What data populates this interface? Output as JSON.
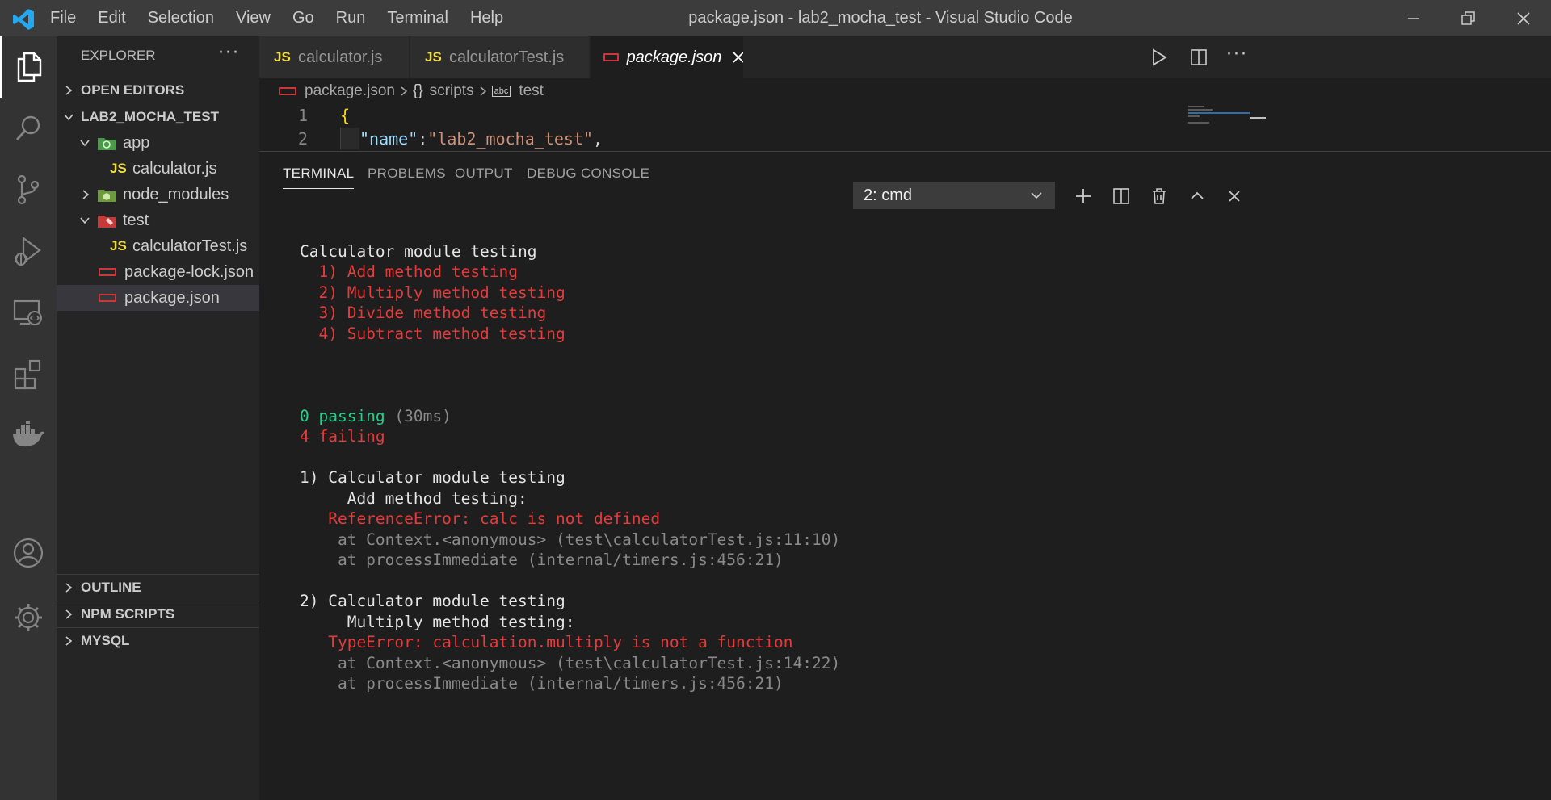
{
  "window": {
    "title": "package.json - lab2_mocha_test - Visual Studio Code",
    "menu": [
      "File",
      "Edit",
      "Selection",
      "View",
      "Go",
      "Run",
      "Terminal",
      "Help"
    ]
  },
  "sidebar": {
    "header": "EXPLORER",
    "more": "···",
    "sections": {
      "open_editors": "OPEN EDITORS",
      "project": "LAB2_MOCHA_TEST",
      "outline": "OUTLINE",
      "npm_scripts": "NPM SCRIPTS",
      "mysql": "MYSQL"
    },
    "tree": {
      "app": "app",
      "calculator_js": "calculator.js",
      "node_modules": "node_modules",
      "test": "test",
      "calculator_test_js": "calculatorTest.js",
      "package_lock": "package-lock.json",
      "package_json": "package.json"
    },
    "js_badge": "JS"
  },
  "tabs": [
    {
      "label": "calculator.js"
    },
    {
      "label": "calculatorTest.js"
    },
    {
      "label": "package.json"
    }
  ],
  "breadcrumb": {
    "file": "package.json",
    "scripts_icon": "{}",
    "scripts": "scripts",
    "test_icon": "abc",
    "test": "test"
  },
  "editor": {
    "lines": [
      {
        "num": "1",
        "brace": "{"
      },
      {
        "num": "2",
        "key": "\"name\"",
        "sep": ": ",
        "value": "\"lab2_mocha_test\"",
        "end": ","
      }
    ]
  },
  "panel": {
    "tabs": [
      "TERMINAL",
      "PROBLEMS",
      "OUTPUT",
      "DEBUG CONSOLE"
    ],
    "terminal_select": "2: cmd",
    "output": {
      "suite": "Calculator module testing",
      "tests": [
        "  1) Add method testing",
        "  2) Multiply method testing",
        "  3) Divide method testing",
        "  4) Subtract method testing"
      ],
      "passing": "0 passing",
      "duration": " (30ms)",
      "failing": "4 failing",
      "failure1": {
        "head": "1) Calculator module testing",
        "test": "     Add method testing:",
        "error": "   ReferenceError: calc is not defined",
        "stack1": "    at Context.<anonymous> (test\\calculatorTest.js:11:10)",
        "stack2": "    at processImmediate (internal/timers.js:456:21)"
      },
      "failure2": {
        "head": "2) Calculator module testing",
        "test": "     Multiply method testing:",
        "error": "   TypeError: calculation.multiply is not a function",
        "stack1": "    at Context.<anonymous> (test\\calculatorTest.js:14:22)",
        "stack2": "    at processImmediate (internal/timers.js:456:21)"
      }
    }
  },
  "colors": {
    "accent_blue": "#23a9f2",
    "js_yellow": "#f1dd3f",
    "npm_red": "#cb3837",
    "error_red": "#e53b3b",
    "pass_green": "#23d18b"
  }
}
